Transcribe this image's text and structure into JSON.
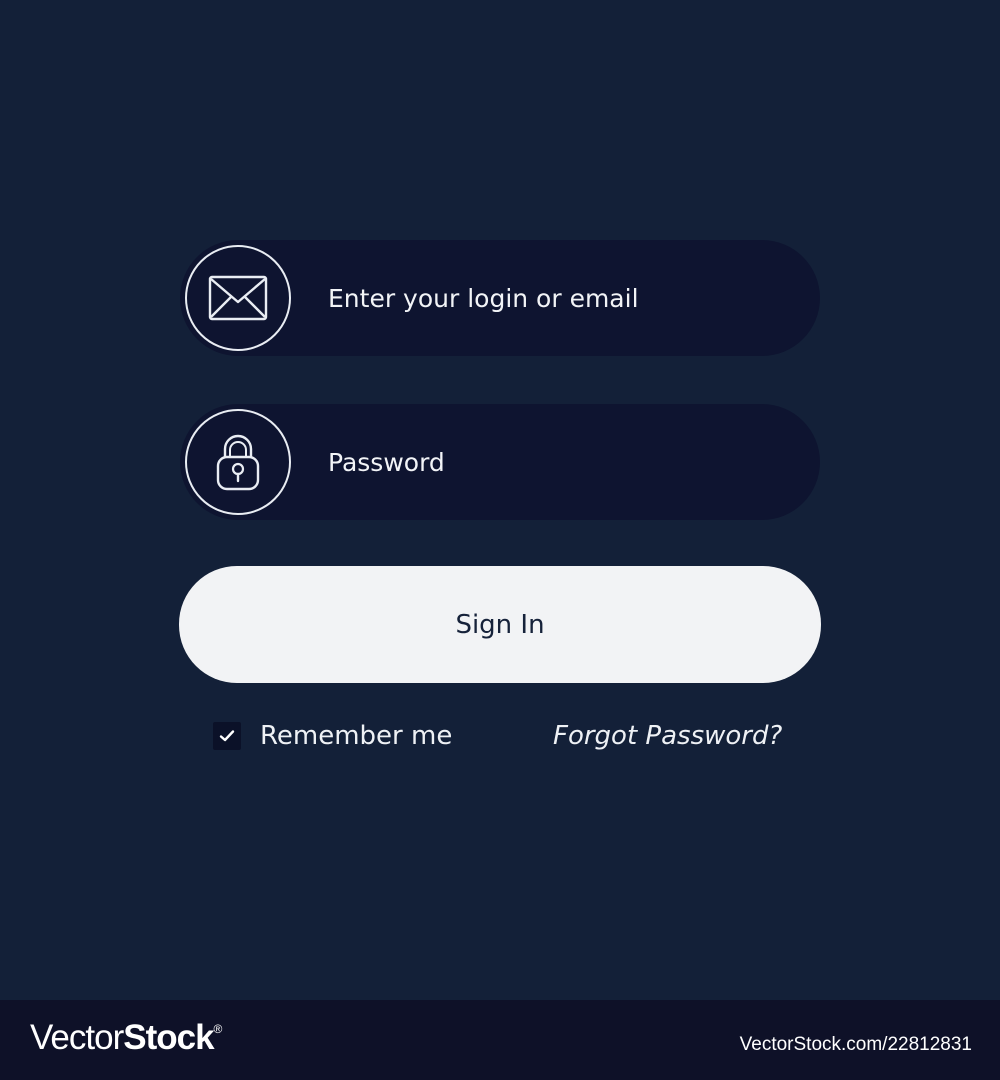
{
  "login_form": {
    "login_field": {
      "placeholder": "Enter your login or email",
      "icon": "envelope-icon"
    },
    "password_field": {
      "placeholder": "Password",
      "icon": "padlock-icon"
    },
    "sign_in_button": {
      "label": "Sign In"
    },
    "remember_me": {
      "label": "Remember me",
      "checked": true
    },
    "forgot_password": {
      "label": "Forgot Password?"
    }
  },
  "watermark": {
    "brand_part1": "Vector",
    "brand_part2": "Stock",
    "brand_mark": "®",
    "image_id_text": "VectorStock.com/22812831"
  },
  "colors": {
    "background": "#132038",
    "field_background": "#0e1430",
    "button_background": "#f2f3f5",
    "button_text": "#16223a",
    "text_light": "#f2f4f7",
    "footer_background": "#0e1128"
  }
}
